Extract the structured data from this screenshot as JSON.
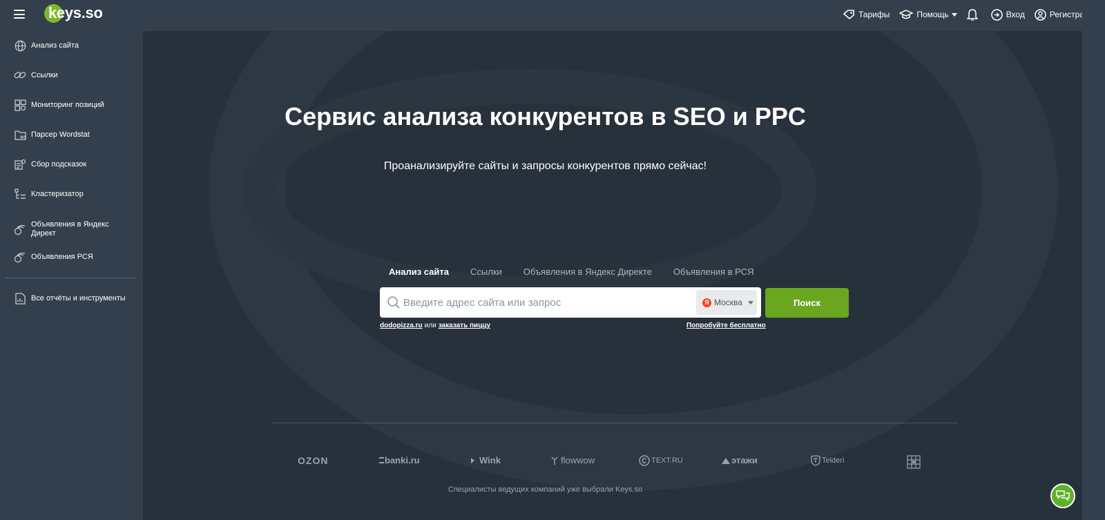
{
  "header": {
    "logo_text": "keys.so",
    "tariffs": "Тарифы",
    "help": "Помощь",
    "login": "Вход",
    "register": "Регистрация"
  },
  "sidebar": {
    "items": [
      {
        "label": "Анализ сайта",
        "icon": "globe-icon"
      },
      {
        "label": "Ссылки",
        "icon": "link-icon"
      },
      {
        "label": "Мониторинг позиций",
        "icon": "grid-monitor-icon"
      },
      {
        "label": "Парсер Wordstat",
        "icon": "folder-ws-icon"
      },
      {
        "label": "Сбор подсказок",
        "icon": "suggest-icon"
      },
      {
        "label": "Кластеризатор",
        "icon": "cluster-icon"
      },
      {
        "label": "Объявления в Яндекс Директ",
        "icon": "ads-icon"
      },
      {
        "label": "Объявления РСЯ",
        "icon": "ads-rsya-icon"
      }
    ],
    "all_reports": "Все отчёты и инструменты"
  },
  "hero": {
    "title": "Сервис анализа конкурентов в SEO и PPC",
    "subtitle": "Проанализируйте сайты и запросы конкурентов прямо сейчас!"
  },
  "tabs": [
    "Анализ сайта",
    "Ссылки",
    "Объявления в Яндекс Директе",
    "Объявления в РСЯ"
  ],
  "search": {
    "placeholder": "Введите адрес сайта или запрос",
    "region": "Москва",
    "region_badge": "Я",
    "button": "Поиск",
    "example_site": "dodopizza.ru",
    "example_or": "или",
    "example_query": "заказать пиццу",
    "try_free": "Попробуйте бесплатно"
  },
  "brands": [
    "OZON",
    "banki.ru",
    "Wink",
    "flowwow",
    "TEXT.RU",
    "этажи",
    "Telderi"
  ],
  "footer_note": "Специалисты ведущих компаний уже выбрали Keys.so",
  "colors": {
    "accent_green": "#6aa61f",
    "sidebar_bg": "#333f4d",
    "main_bg": "#27313c"
  }
}
